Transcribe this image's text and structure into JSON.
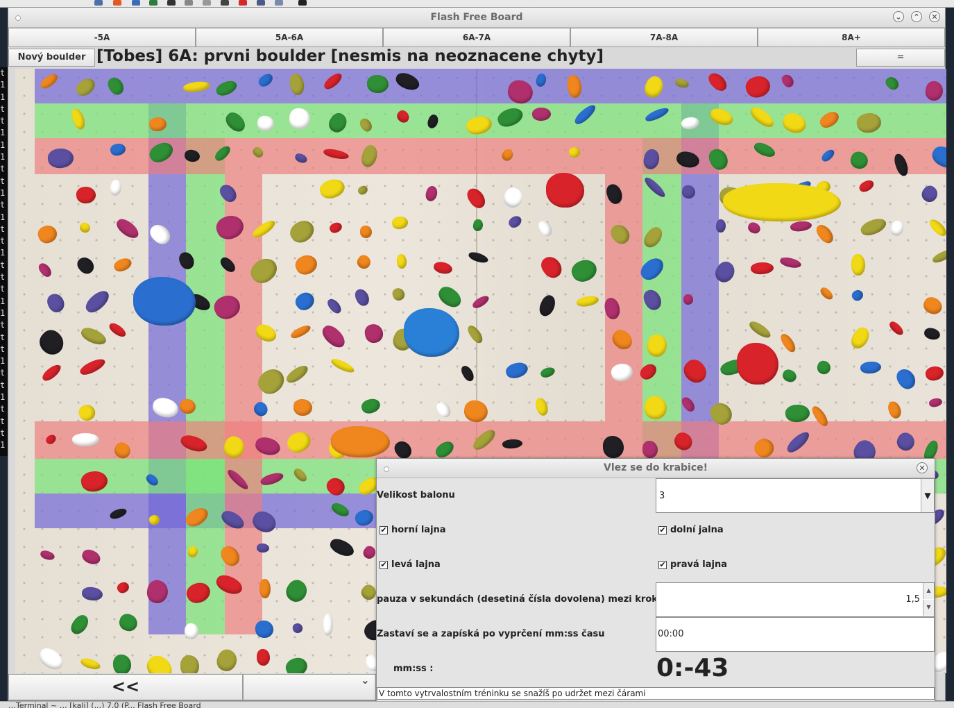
{
  "window": {
    "title": "Flash Free Board"
  },
  "grades": [
    "-5A",
    "5A-6A",
    "6A-7A",
    "7A-8A",
    "8A+"
  ],
  "toolbar": {
    "new_boulder_label": "Nový boulder",
    "boulder_title": "[Tobes] 6A: prvni boulder [nesmis na neoznacene chyty]",
    "right_button_label": "="
  },
  "bottom": {
    "back_label": "<<",
    "combo_arrow": "⌄"
  },
  "terminal_lines": [
    "t",
    "1",
    "1",
    "t",
    "t",
    "1",
    "1",
    "1",
    "t",
    "t",
    "1",
    "t",
    "1",
    "t",
    "t",
    "1",
    "t",
    "t",
    "t",
    "1",
    "1",
    "t",
    "t",
    "t",
    "1",
    "t",
    "t",
    "1",
    "t",
    "t",
    "t",
    "1"
  ],
  "dialog": {
    "title": "Vlez se do krabice!",
    "balloon_size_label": "Velikost balonu",
    "balloon_size_value": "3",
    "top_line_label": "horní lajna",
    "bottom_line_label": "dolní jalna",
    "left_line_label": "levá lajna",
    "right_line_label": "pravá lajna",
    "pause_label": "pauza v sekundách (desetiná čísla dovolena) mezi kroky",
    "pause_value": "1,5",
    "stop_label": "Zastaví se a zapíská po  vyprčení mm:ss času",
    "stop_value": "00:00",
    "mmss_label": "mm:ss :",
    "timer_value": "0:-43",
    "hint_text": "V tomto vytrvalostním tréninku se snažíš po udržet mezi čárami"
  },
  "taskbar_text": "…Terminal  ~ …  [kali] (...)  7.0 (P...   Flash Free Board",
  "colors": {
    "blue_band": "#7d70d6",
    "green_band": "#86e28a",
    "red_band": "#ee8e8e",
    "hold_colors": [
      "#d8232a",
      "#f2d916",
      "#1f1f24",
      "#2a6ed0",
      "#2f8f36",
      "#f0861e",
      "#a6a23a",
      "#b0306e",
      "#5a4fa0",
      "#ffffff"
    ]
  }
}
